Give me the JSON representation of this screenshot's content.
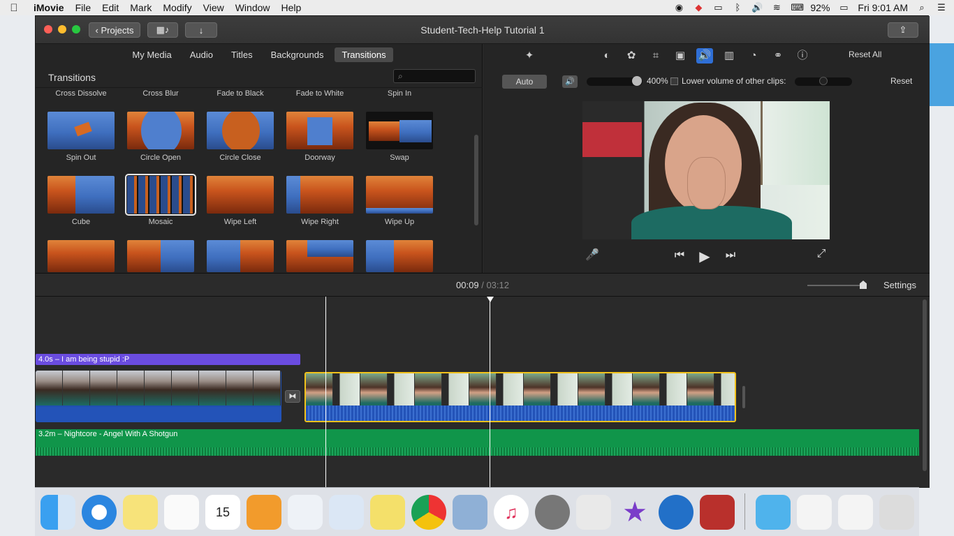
{
  "menubar": {
    "app_name": "iMovie",
    "menus": [
      "File",
      "Edit",
      "Mark",
      "Modify",
      "View",
      "Window",
      "Help"
    ],
    "battery": "92%",
    "clock": "Fri 9:01 AM"
  },
  "window": {
    "title": "Student-Tech-Help Tutorial 1",
    "projects_label": "Projects"
  },
  "browser": {
    "tabs": [
      "My Media",
      "Audio",
      "Titles",
      "Backgrounds",
      "Transitions"
    ],
    "active_tab": "Transitions",
    "section_title": "Transitions",
    "top_row_labels": [
      "Cross Dissolve",
      "Cross Blur",
      "Fade to Black",
      "Fade to White",
      "Spin In"
    ],
    "row1": [
      "Spin Out",
      "Circle Open",
      "Circle Close",
      "Doorway",
      "Swap"
    ],
    "row2": [
      "Cube",
      "Mosaic",
      "Wipe Left",
      "Wipe Right",
      "Wipe Up"
    ],
    "selected": "Mosaic"
  },
  "inspector": {
    "reset_all": "Reset All",
    "auto": "Auto",
    "volume_pct": "400%",
    "lower_volume_label": "Lower volume of other clips:",
    "reset": "Reset",
    "active_tool": "volume"
  },
  "timeline": {
    "current_time": "00:09",
    "separator": "/",
    "total_time": "03:12",
    "settings": "Settings",
    "title_clip": "4.0s – I am being stupid :P",
    "music_clip": "3.2m – Nightcore - Angel With A Shotgun"
  },
  "colors": {
    "accent": "#2f6fd6",
    "title_clip": "#6a4ce0",
    "music_clip": "#10954a",
    "selected_clip_border": "#f2c21b"
  }
}
